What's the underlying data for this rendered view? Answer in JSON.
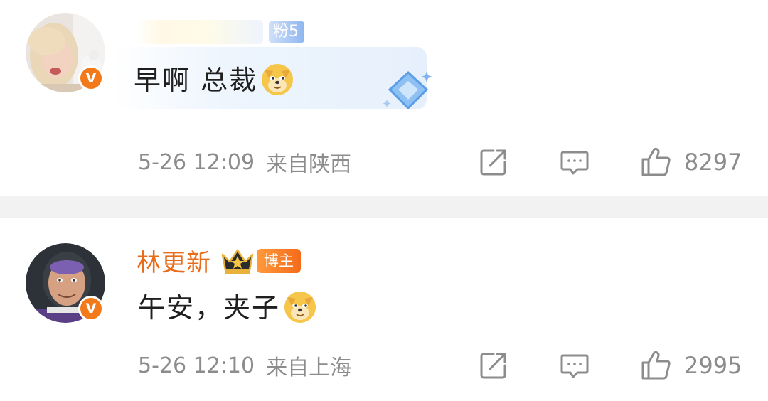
{
  "comments": [
    {
      "username": "",
      "fan_badge": "粉5",
      "text": "早啊 总裁",
      "time": "5-26 12:09",
      "location": "来自陕西",
      "likes": "8297",
      "verified_label": "V",
      "emoji": "doge-emoji"
    },
    {
      "username": "林更新",
      "badge": "博主",
      "text": "午安，夹子",
      "time": "5-26 12:10",
      "location": "来自上海",
      "likes": "2995",
      "verified_label": "V",
      "emoji": "doge-emoji"
    }
  ],
  "colors": {
    "username": "#e86c1a",
    "meta": "#8c8c8c",
    "text": "#1f1f1f",
    "divider": "#f2f2f2",
    "verified": "#f27a1a"
  },
  "icons": [
    "share-icon",
    "reply-icon",
    "like-icon",
    "crown-icon",
    "diamond-icon"
  ]
}
